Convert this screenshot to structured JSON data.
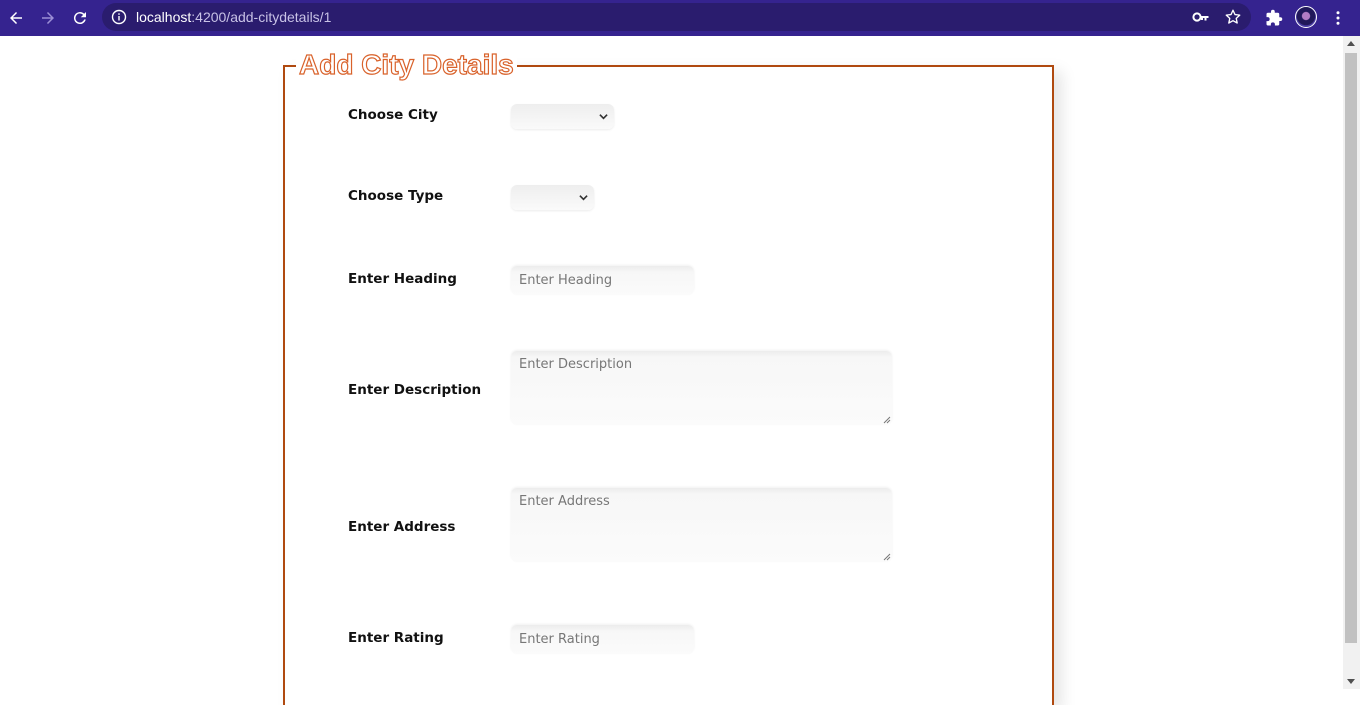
{
  "browser": {
    "url_host": "localhost",
    "url_path": ":4200/add-citydetails/1"
  },
  "form": {
    "title": "Add City Details",
    "fields": {
      "city": {
        "label": "Choose City",
        "value": ""
      },
      "type": {
        "label": "Choose Type",
        "value": ""
      },
      "heading": {
        "label": "Enter Heading",
        "placeholder": "Enter Heading"
      },
      "description": {
        "label": "Enter Description",
        "placeholder": "Enter Description"
      },
      "address": {
        "label": "Enter Address",
        "placeholder": "Enter Address"
      },
      "rating": {
        "label": "Enter Rating",
        "placeholder": "Enter Rating"
      }
    }
  },
  "colors": {
    "toolbar": "#35238f",
    "omnibox": "#2a1c6e",
    "fieldset_border": "#b04a10",
    "legend_stroke": "#d9622b"
  },
  "icons": [
    "back-arrow-icon",
    "forward-arrow-icon",
    "reload-icon",
    "info-icon",
    "key-icon",
    "star-icon",
    "extensions-icon",
    "avatar",
    "kebab-menu-icon",
    "chevron-down-icon"
  ]
}
